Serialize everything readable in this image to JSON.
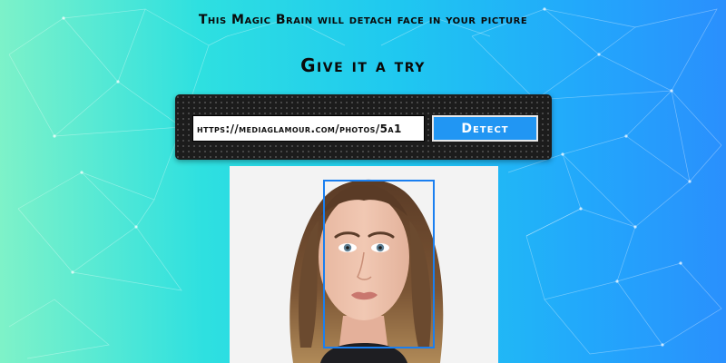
{
  "header": {
    "headline": "This Magic Brain will detach face in your picture",
    "subheadline": "Give it a try"
  },
  "form": {
    "url_value": "https://mediaglamour.com/photos/5a1",
    "detect_label": "Detect"
  },
  "colors": {
    "gradient_left": "#7ff2c8",
    "gradient_right": "#2a8ffd",
    "panel_background": "#1c1c1c",
    "button_background": "#2196f3",
    "face_box_border": "#1a7ff0"
  },
  "icons": {
    "background": "particle-network-pattern"
  }
}
